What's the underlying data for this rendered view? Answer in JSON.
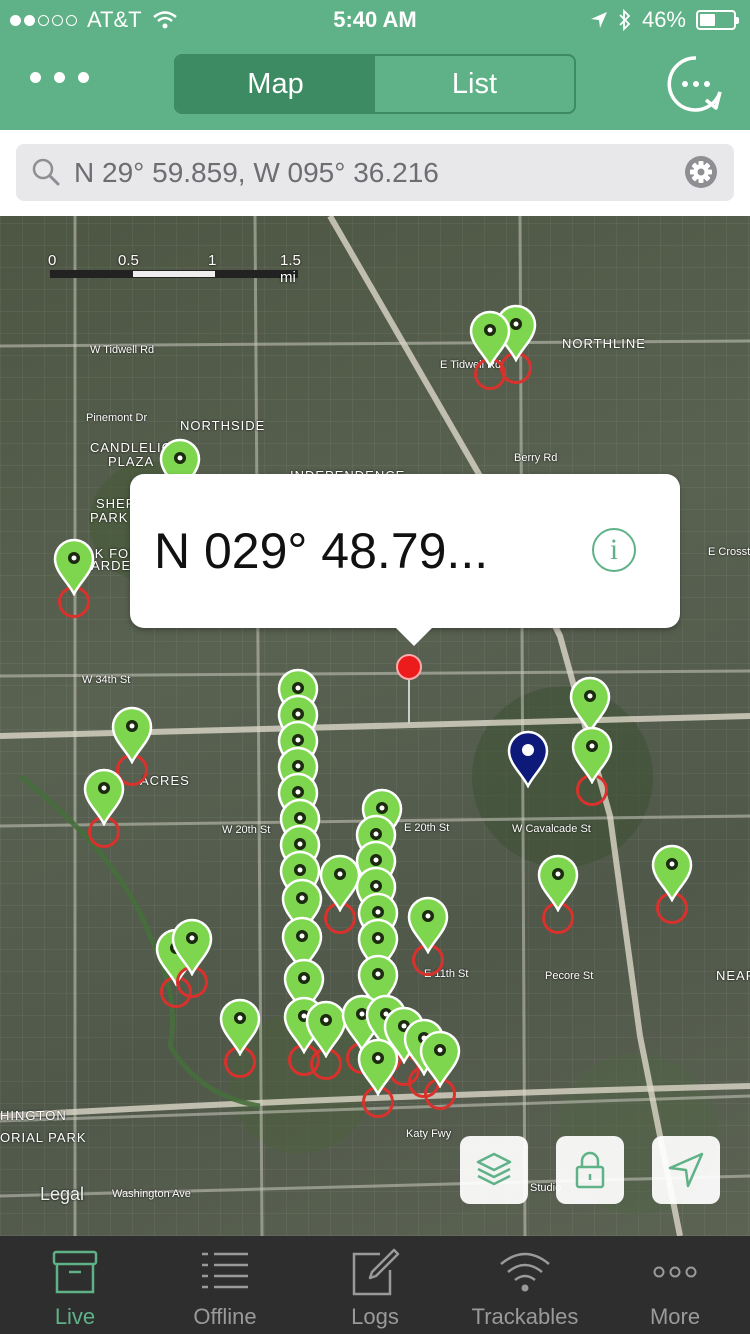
{
  "status_bar": {
    "carrier": "AT&T",
    "time": "5:40 AM",
    "battery": "46%",
    "battery_level": 0.46
  },
  "header": {
    "tabs": [
      {
        "label": "Map",
        "active": true
      },
      {
        "label": "List",
        "active": false
      }
    ]
  },
  "search": {
    "value": "N 29° 59.859, W 095° 36.216"
  },
  "map": {
    "scale_labels": [
      "0",
      "0.5",
      "1",
      "1.5 mi"
    ],
    "labels": {
      "northline": "NORTHLINE",
      "northside": "NORTHSIDE",
      "candlelight": "CANDLELIGHT",
      "plaza": "PLAZA",
      "independence": "INDEPENDENCE",
      "shepherd_park": "SHEPHERD",
      "shepherd_park2": "PARK PL",
      "oak_forest": "OAK FOREST",
      "garden": "GARDEN",
      "acres": "ACRES",
      "w_tidwell": "W Tidwell Rd",
      "e_tidwell": "E Tidwell Rd",
      "w_34th": "W 34th St",
      "w_20th": "W 20th St",
      "e_20th": "E 20th St",
      "w_cavalcade": "W Cavalcade St",
      "e_11th": "E 11th St",
      "pecore": "Pecore St",
      "katy_fwy": "Katy Fwy",
      "washington": "Washington Ave",
      "studio": "Studio",
      "houston": "HINGTON",
      "memorial_park": "ORIAL PARK",
      "near": "NEAR",
      "berry_rd": "Berry Rd",
      "e_crosstimbers": "E Crosst",
      "pinemont": "Pinemont Dr"
    },
    "callout": {
      "text": "N 029° 48.79...",
      "info_icon": "info-icon"
    },
    "legal": "Legal",
    "buttons": [
      "layers-icon",
      "lock-icon",
      "location-arrow-icon"
    ]
  },
  "tabbar": {
    "items": [
      {
        "label": "Live",
        "icon": "box-icon",
        "active": true
      },
      {
        "label": "Offline",
        "icon": "list-icon",
        "active": false
      },
      {
        "label": "Logs",
        "icon": "pencil-square-icon",
        "active": false
      },
      {
        "label": "Trackables",
        "icon": "wifi-icon",
        "active": false
      },
      {
        "label": "More",
        "icon": "more-dots-icon",
        "active": false
      }
    ]
  },
  "colors": {
    "brand_green": "#5fb187",
    "pin_green": "#7ed64e",
    "pin_navy": "#0d1a7a",
    "ring_red": "#d9312c"
  }
}
